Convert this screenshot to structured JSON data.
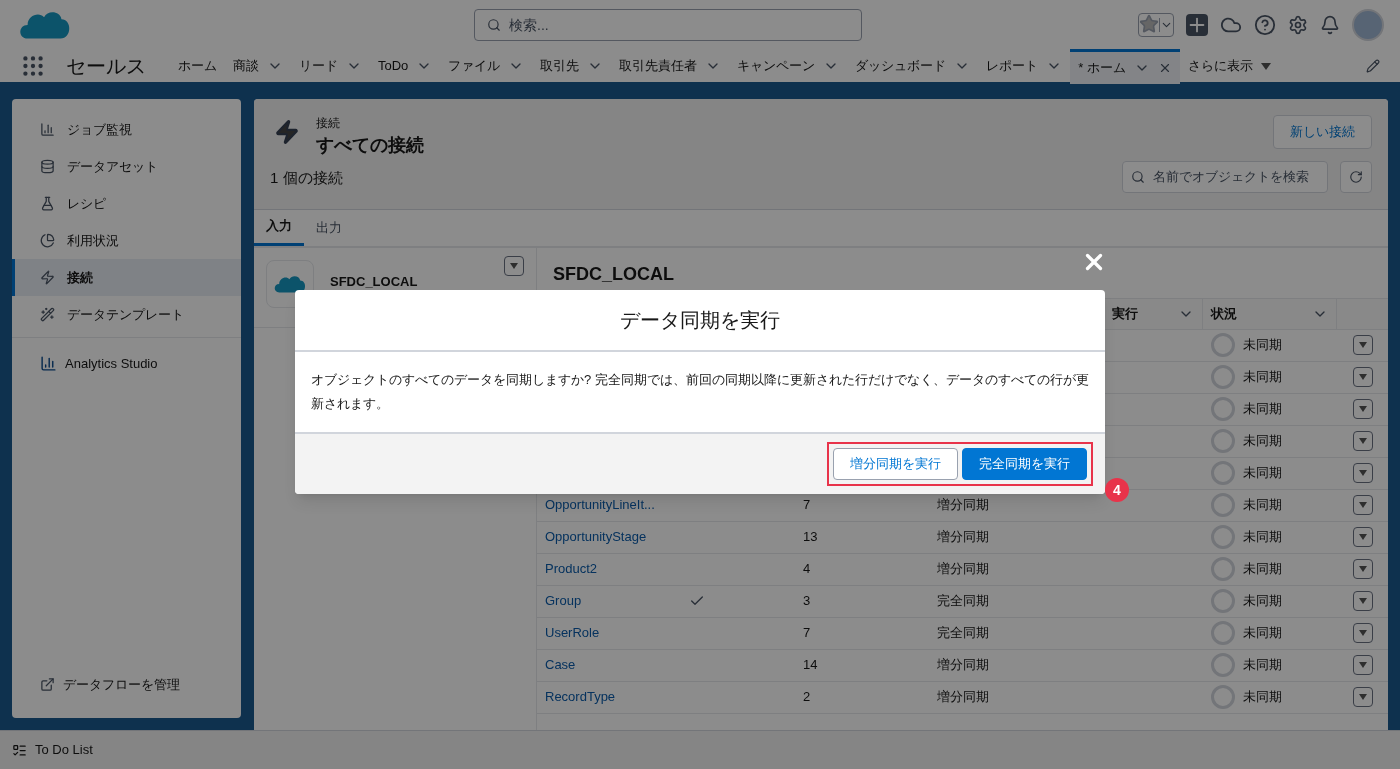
{
  "header": {
    "search_placeholder": "検索..."
  },
  "app_name": "セールス",
  "nav": [
    {
      "label": "ホーム",
      "dropdown": false,
      "selected": false
    },
    {
      "label": "商談",
      "dropdown": true,
      "selected": false
    },
    {
      "label": "リード",
      "dropdown": true,
      "selected": false
    },
    {
      "label": "ToDo",
      "dropdown": true,
      "selected": false
    },
    {
      "label": "ファイル",
      "dropdown": true,
      "selected": false
    },
    {
      "label": "取引先",
      "dropdown": true,
      "selected": false
    },
    {
      "label": "取引先責任者",
      "dropdown": true,
      "selected": false
    },
    {
      "label": "キャンペーン",
      "dropdown": true,
      "selected": false
    },
    {
      "label": "ダッシュボード",
      "dropdown": true,
      "selected": false
    },
    {
      "label": "レポート",
      "dropdown": true,
      "selected": false
    },
    {
      "label": "* ホーム",
      "dropdown": true,
      "selected": true,
      "closable": true
    }
  ],
  "nav_more": "さらに表示",
  "sidebar": {
    "items": [
      {
        "label": "ジョブ監視",
        "selected": false
      },
      {
        "label": "データアセット",
        "selected": false
      },
      {
        "label": "レシピ",
        "selected": false
      },
      {
        "label": "利用状況",
        "selected": false
      },
      {
        "label": "接続",
        "selected": true
      },
      {
        "label": "データテンプレート",
        "selected": false
      }
    ],
    "studio": "Analytics Studio",
    "manage": "データフローを管理"
  },
  "page": {
    "eyebrow": "接続",
    "title": "すべての接続",
    "count": "1 個の接続",
    "new_button": "新しい接続",
    "search_placeholder": "名前でオブジェクトを検索"
  },
  "tabs": [
    {
      "label": "入力",
      "selected": true
    },
    {
      "label": "出力",
      "selected": false
    }
  ],
  "connection": {
    "name": "SFDC_LOCAL"
  },
  "detail": {
    "title": "SFDC_LOCAL",
    "columns": [
      "実行",
      "状況"
    ],
    "rows": [
      {
        "status": "未同期"
      },
      {
        "status": "未同期"
      },
      {
        "status": "未同期"
      },
      {
        "status": "未同期"
      },
      {
        "status": "未同期"
      },
      {
        "name": "OpportunityLineIt...",
        "checked": false,
        "count": "7",
        "sync": "増分同期",
        "status": "未同期"
      },
      {
        "name": "OpportunityStage",
        "checked": false,
        "count": "13",
        "sync": "増分同期",
        "status": "未同期"
      },
      {
        "name": "Product2",
        "checked": false,
        "count": "4",
        "sync": "増分同期",
        "status": "未同期"
      },
      {
        "name": "Group",
        "checked": true,
        "count": "3",
        "sync": "完全同期",
        "status": "未同期"
      },
      {
        "name": "UserRole",
        "checked": false,
        "count": "7",
        "sync": "完全同期",
        "status": "未同期"
      },
      {
        "name": "Case",
        "checked": false,
        "count": "14",
        "sync": "増分同期",
        "status": "未同期"
      },
      {
        "name": "RecordType",
        "checked": false,
        "count": "2",
        "sync": "増分同期",
        "status": "未同期"
      }
    ]
  },
  "modal": {
    "title": "データ同期を実行",
    "body": "オブジェクトのすべてのデータを同期しますか? 完全同期では、前回の同期以降に更新された行だけでなく、データのすべての行が更新されます。",
    "buttons": [
      {
        "label": "増分同期を実行",
        "kind": "neutral"
      },
      {
        "label": "完全同期を実行",
        "kind": "brand"
      }
    ],
    "annotation": "4"
  },
  "footer": {
    "label": "To Do List"
  }
}
